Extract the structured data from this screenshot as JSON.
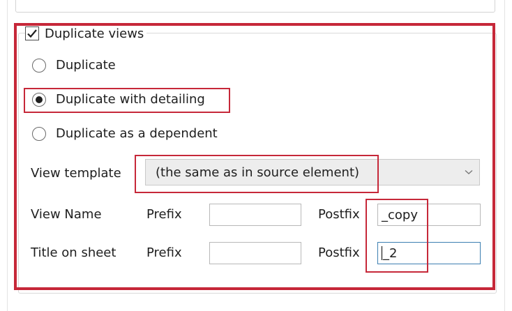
{
  "group": {
    "checkbox_label": "Duplicate views",
    "checkbox_checked": true
  },
  "radios": [
    {
      "label": "Duplicate",
      "selected": false
    },
    {
      "label": "Duplicate with detailing",
      "selected": true
    },
    {
      "label": "Duplicate as a dependent",
      "selected": false
    }
  ],
  "view_template": {
    "label": "View template",
    "value": "(the same as in source element)"
  },
  "view_name": {
    "label": "View Name",
    "prefix_label": "Prefix",
    "prefix_value": "",
    "postfix_label": "Postfix",
    "postfix_value": "_copy"
  },
  "title_on_sheet": {
    "label": "Title on sheet",
    "prefix_label": "Prefix",
    "prefix_value": "",
    "postfix_label": "Postfix",
    "postfix_value": "_2"
  },
  "colors": {
    "annotation_red": "#c62839",
    "focus_blue": "#3c7fb1"
  }
}
